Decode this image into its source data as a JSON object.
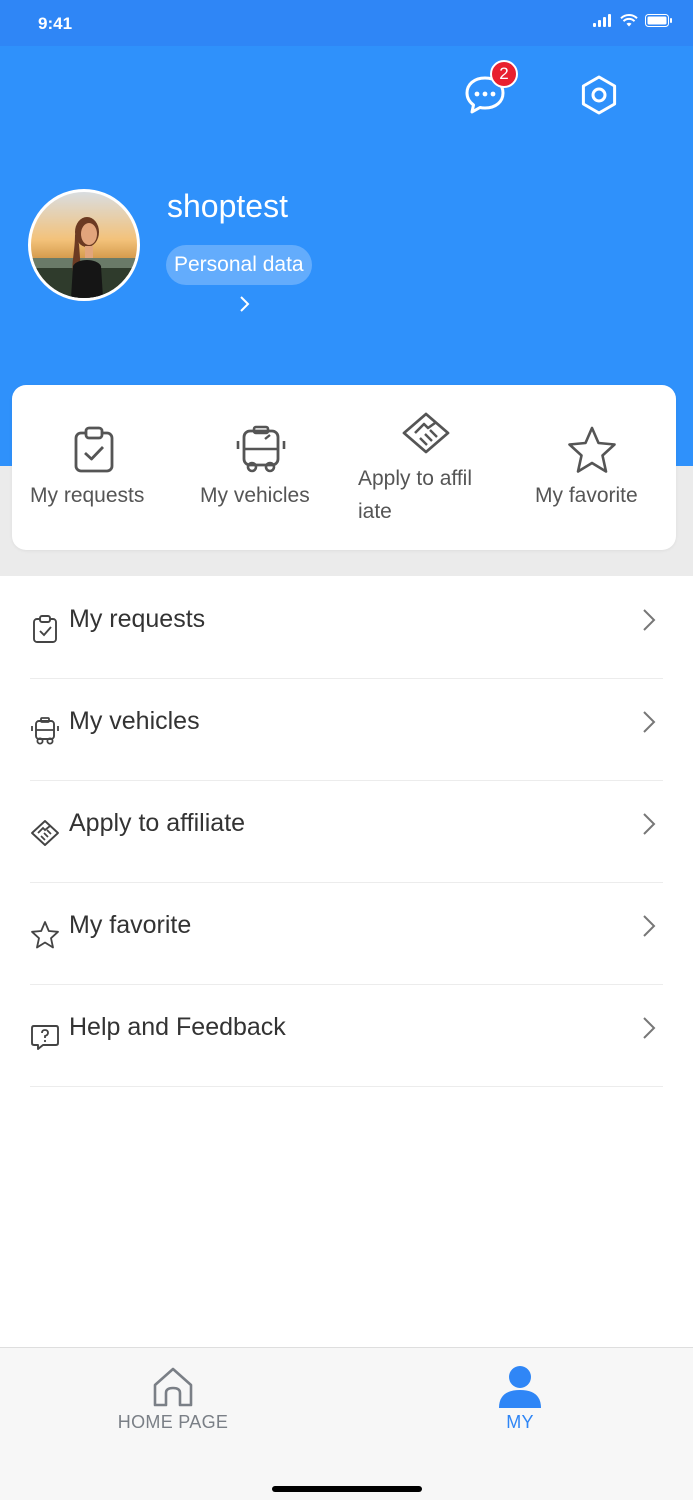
{
  "status_bar": {
    "time": "9:41"
  },
  "header": {
    "message_badge_count": "2",
    "username": "shoptest",
    "personal_data_label": "Personal data"
  },
  "quick_actions": [
    {
      "label": "My requests",
      "icon": "clipboard-check-icon"
    },
    {
      "label": "My vehicles",
      "icon": "bus-icon"
    },
    {
      "label": "Apply to affil",
      "label_line2": "iate",
      "icon": "handshake-icon"
    },
    {
      "label": "My favorite",
      "icon": "star-icon"
    }
  ],
  "menu": [
    {
      "label": "My requests",
      "icon": "clipboard-check-icon"
    },
    {
      "label": "My vehicles",
      "icon": "bus-icon"
    },
    {
      "label": "Apply to affiliate",
      "icon": "handshake-icon"
    },
    {
      "label": "My favorite",
      "icon": "star-icon"
    },
    {
      "label": "Help and Feedback",
      "icon": "help-chat-icon"
    }
  ],
  "tab_bar": {
    "home_label": "HOME PAGE",
    "my_label": "MY"
  },
  "colors": {
    "brand_blue": "#2f91fb",
    "badge_red": "#e8202f",
    "inactive_tab": "#7a7f86",
    "active_tab": "#2f86f6"
  }
}
